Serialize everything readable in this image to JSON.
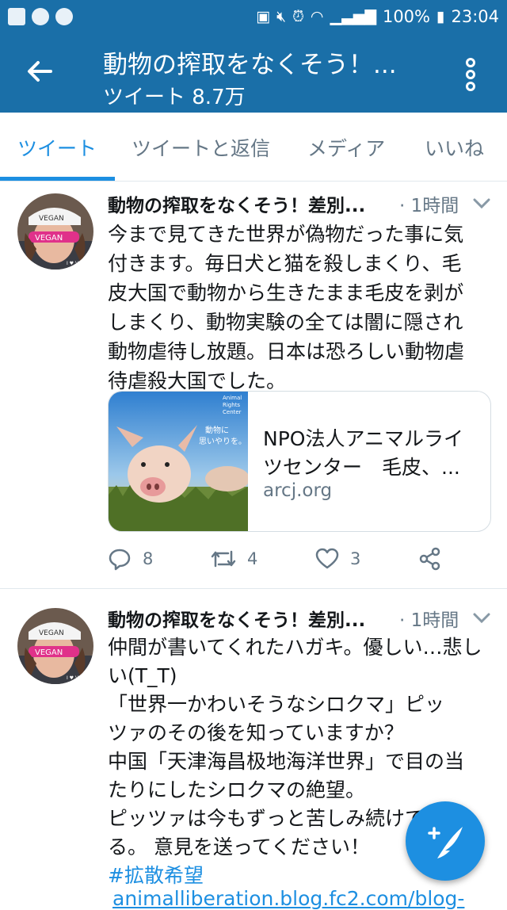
{
  "status_bar": {
    "battery": "100%",
    "time": "23:04"
  },
  "header": {
    "title": "動物の搾取をなくそう！...",
    "subtitle": "ツイート 8.7万",
    "back_icon": "arrow-left-icon",
    "menu_icon": "more-vertical-icon"
  },
  "tabs": [
    {
      "label": "ツイート",
      "active": true
    },
    {
      "label": "ツイートと返信",
      "active": false
    },
    {
      "label": "メディア",
      "active": false
    },
    {
      "label": "いいね",
      "active": false
    }
  ],
  "tweets": [
    {
      "name": "動物の搾取をなくそう！差別...",
      "time": "· 1時間",
      "avatar_text": {
        "cap": "VEGAN",
        "glasses": "VEGAN",
        "shirt": "I ♥ VEGAN"
      },
      "lines": [
        "今まで見てきた世界が偽物だった事に気",
        "付きます。毎日犬と猫を殺しまくり、毛",
        "皮大国で動物から生きたまま毛皮を剥が",
        "しまくり、動物実験の全ては闇に隠され",
        "動物虐待し放題。日本は恐ろしい動物虐",
        "待虐殺大国でした。"
      ],
      "card": {
        "image_caption_line1": "動物に",
        "image_caption_line2": "思いやりを。",
        "image_logo": "Animal\nRights\nCenter",
        "title_line1": "NPO法人アニマルライ",
        "title_line2": "ツセンター　毛皮、...",
        "url": "arcj.org"
      },
      "actions": {
        "replies": "8",
        "retweets": "4",
        "likes": "3"
      }
    },
    {
      "name": "動物の搾取をなくそう！差別...",
      "time": "· 1時間",
      "lines": [
        "仲間が書いてくれたハガキ。優しい…悲し",
        "い(T_T)",
        "「世界一かわいそうなシロクマ」ピッ",
        "ツァのその後を知っていますか？",
        "中国「天津海昌极地海洋世界」で目の当",
        "たりにしたシロクマの絶望。",
        "ピッツァは今もずっと苦しみ続けて",
        "る。 意見を送ってください！"
      ],
      "hashtag": "#拡散希望",
      "link": "animalliberation.blog.fc2.com/blog-"
    }
  ],
  "fab": {
    "icon": "compose-feather-icon"
  },
  "colors": {
    "brand": "#1a6fa8",
    "accent": "#1d8fe1",
    "muted": "#657786"
  }
}
